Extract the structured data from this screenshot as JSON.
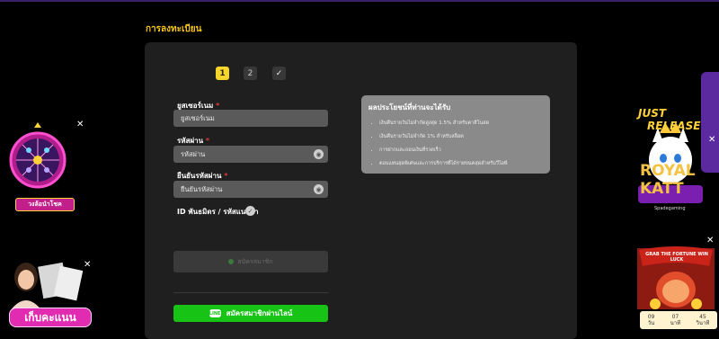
{
  "page": {
    "title": "การลงทะเบียน"
  },
  "steps": [
    "1",
    "2",
    "✓"
  ],
  "form": {
    "username": {
      "label": "ยูสเซอร์เนม",
      "required": "*",
      "placeholder": "ยูสเซอร์เนม"
    },
    "password": {
      "label": "รหัสผ่าน",
      "required": "*",
      "placeholder": "รหัสผ่าน"
    },
    "confirm": {
      "label": "ยืนยันรหัสผ่าน",
      "required": "*",
      "placeholder": "ยืนยันรหัสผ่าน"
    },
    "partner_label": "ID พันธมิตร / รหัสแนะนำ",
    "submit_label": "สมัครสมาชิก",
    "line_label": "สมัครสมาชิกผ่านไลน์",
    "line_icon": "LINE"
  },
  "benefits": {
    "title": "ผลประโยชน์ที่ท่านจะได้รับ",
    "items": [
      "เงินคืนรายวันไม่จำกัดสูงสุด 1.5% สำหรับคาสิโนสด",
      "เงินคืนรายวันไม่จำกัด 1% สำหรับสล็อต",
      "การฝากและถอนเงินที่รวดเร็ว",
      "ตอบแทนสุดพิเศษและการบริการที่ได้รายขนคสุดสำหรับวีไอพี"
    ]
  },
  "promos": {
    "wheel_label": "วงล้อนำโชค",
    "points_label": "เก็บคะแนน",
    "slot": {
      "line1": "JUST",
      "line2": "RELEASE",
      "name": "ROYAL KATT",
      "provider": "Spadegaming"
    },
    "fortune": {
      "headline": "GRAB THE FORTUNE WIN LUCK",
      "timer": [
        {
          "value": "09",
          "unit": "วัน"
        },
        {
          "value": "07",
          "unit": "นาที"
        },
        {
          "value": "45",
          "unit": "วินาที"
        }
      ]
    }
  },
  "icons": {
    "close": "✕",
    "eye": "◉",
    "check": "✓"
  },
  "colors": {
    "accent": "#f5c518",
    "line_green": "#17c416",
    "required": "#e23a3a"
  }
}
